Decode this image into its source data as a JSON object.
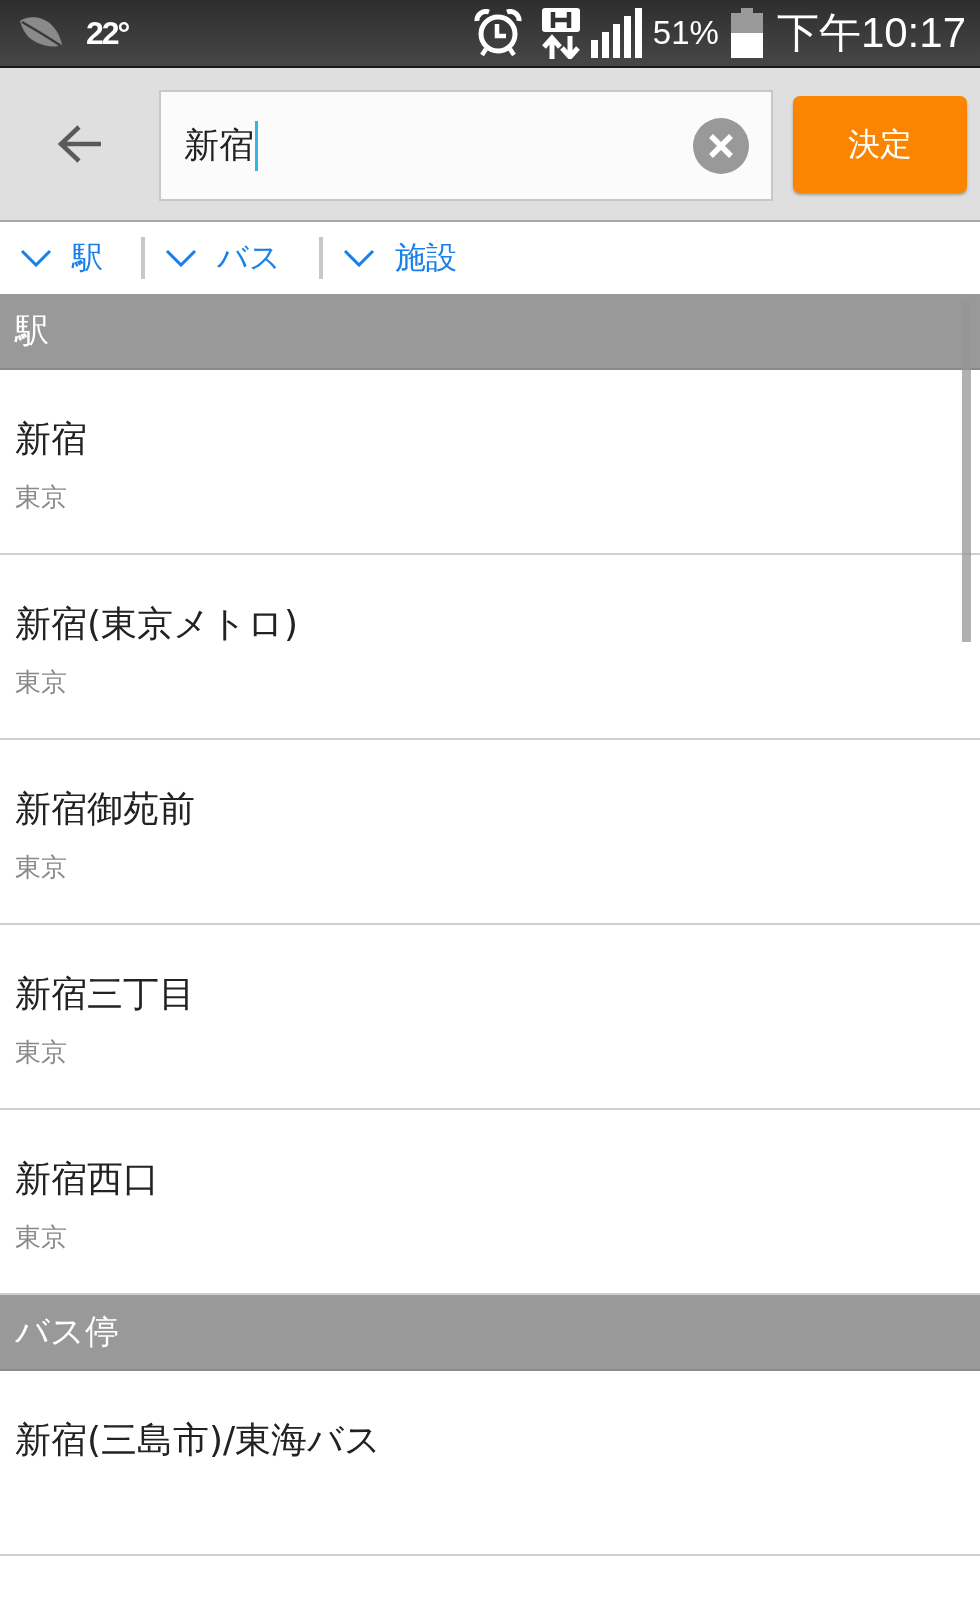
{
  "status_bar": {
    "temperature": "22°",
    "battery_percent": "51%",
    "time": "下午10:17"
  },
  "search_bar": {
    "value": "新宿",
    "confirm_button": "決定"
  },
  "filters": [
    {
      "label": "駅"
    },
    {
      "label": "バス"
    },
    {
      "label": "施設"
    }
  ],
  "sections": [
    {
      "title": "駅",
      "items": [
        {
          "name": "新宿",
          "area": "東京"
        },
        {
          "name": "新宿(東京メトロ)",
          "area": "東京"
        },
        {
          "name": "新宿御苑前",
          "area": "東京"
        },
        {
          "name": "新宿三丁目",
          "area": "東京"
        },
        {
          "name": "新宿西口",
          "area": "東京"
        }
      ]
    },
    {
      "title": "バス停",
      "items": [
        {
          "name": "新宿(三島市)/東海バス"
        }
      ]
    }
  ]
}
